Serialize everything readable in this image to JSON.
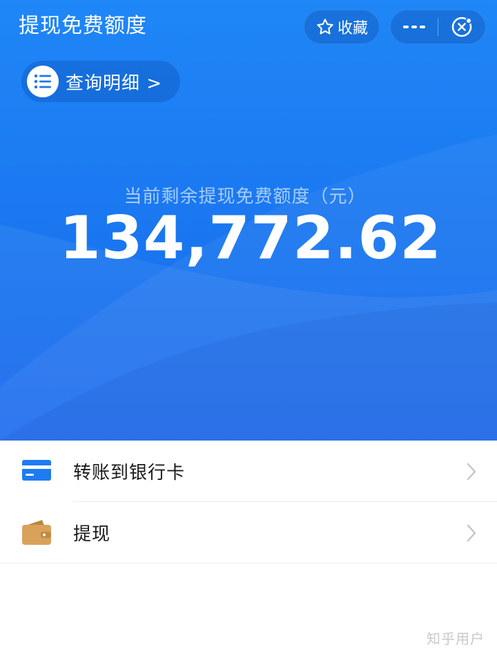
{
  "header": {
    "title": "提现免费额度",
    "favorite_label": "收藏",
    "favorite_icon": "star-outline-icon",
    "more_icon": "more-dots-icon",
    "close_icon": "close-circle-icon"
  },
  "query": {
    "icon": "list-icon",
    "label": "查询明细 >"
  },
  "balance": {
    "caption": "当前剩余提现免费额度（元）",
    "amount": "134,772.62"
  },
  "menu": {
    "items": [
      {
        "label": "转账到银行卡",
        "icon": "bank-card-icon"
      },
      {
        "label": "提现",
        "icon": "wallet-icon"
      }
    ]
  },
  "watermark": "知乎用户",
  "colors": {
    "primary_blue": "#1a76f0",
    "card_blue": "#1e7cf2",
    "wallet_orange": "#d9a25b"
  }
}
